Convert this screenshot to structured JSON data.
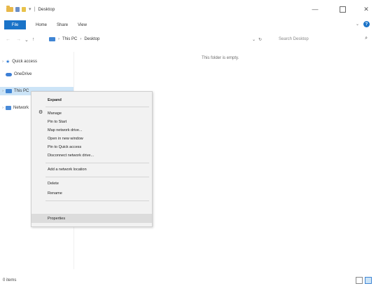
{
  "window": {
    "title": "Desktop",
    "controls": {
      "minimize": "—",
      "maximize": "",
      "close": "✕"
    }
  },
  "ribbon": {
    "tabs": [
      "File",
      "Home",
      "Share",
      "View"
    ],
    "expand_glyph": "⌄",
    "help_glyph": "?"
  },
  "address": {
    "back": "←",
    "forward": "→",
    "up_list": "⌄",
    "up": "↑",
    "crumbs": [
      "This PC",
      "Desktop"
    ],
    "crumb_sep": "›",
    "dropdown": "⌄",
    "refresh": "↻",
    "search_placeholder": "Search Desktop",
    "search_glyph": "⌕"
  },
  "nav": {
    "items": [
      {
        "label": "Quick access",
        "expander": "›"
      },
      {
        "label": "OneDrive",
        "expander": ""
      },
      {
        "label": "This PC",
        "expander": "›"
      },
      {
        "label": "Network",
        "expander": "›"
      }
    ]
  },
  "content": {
    "empty_message": "This folder is empty."
  },
  "context_menu": {
    "items": [
      {
        "label": "Expand"
      },
      {
        "label": "Manage",
        "icon": "gear"
      },
      {
        "label": "Pin to Start"
      },
      {
        "label": "Map network drive..."
      },
      {
        "label": "Open in new window"
      },
      {
        "label": "Pin to Quick access"
      },
      {
        "label": "Disconnect network drive..."
      },
      {
        "label": "Add a network location"
      },
      {
        "label": "Delete"
      },
      {
        "label": "Rename"
      },
      {
        "label": "Properties"
      }
    ]
  },
  "status": {
    "text": "0 items"
  },
  "colors": {
    "accent": "#1a73c8",
    "folder": "#e8b84a",
    "selection": "#cce4f7",
    "menu_bg": "#f2f2f2",
    "menu_hover": "#dcdcdc"
  }
}
